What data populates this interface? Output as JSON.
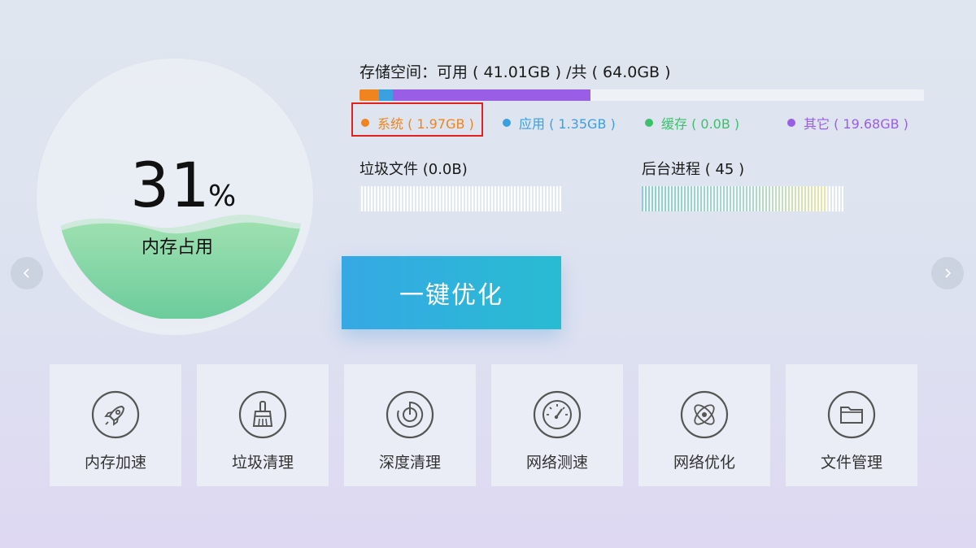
{
  "memory": {
    "percent": "31",
    "percent_sign": "%",
    "label": "内存占用"
  },
  "storage": {
    "title": "存储空间：可用 ( 41.01GB ) /共 ( 64.0GB )",
    "segments": [
      {
        "name": "系统",
        "size_gb": 1.97,
        "color": "#f0841e"
      },
      {
        "name": "应用",
        "size_gb": 1.35,
        "color": "#3aa0e0"
      },
      {
        "name": "缓存",
        "size_gb": 0.0,
        "color": "#3cc06a"
      },
      {
        "name": "其它",
        "size_gb": 19.68,
        "color": "#9a5ee6"
      }
    ],
    "total_gb": 64.0,
    "legend": {
      "system": "系统 ( 1.97GB )",
      "apps": "应用 ( 1.35GB )",
      "cache": "缓存 ( 0.0B )",
      "other": "其它 ( 19.68GB )"
    }
  },
  "junk": {
    "title": "垃圾文件 (0.0B)"
  },
  "processes": {
    "title": "后台进程 ( 45 )",
    "level": 0.91
  },
  "optimize_button": {
    "label": "一键优化"
  },
  "tools": [
    {
      "label": "内存加速",
      "icon": "rocket-icon"
    },
    {
      "label": "垃圾清理",
      "icon": "broom-icon"
    },
    {
      "label": "深度清理",
      "icon": "deep-clean-icon"
    },
    {
      "label": "网络测速",
      "icon": "speedometer-icon"
    },
    {
      "label": "网络优化",
      "icon": "atom-icon"
    },
    {
      "label": "文件管理",
      "icon": "folder-icon"
    }
  ],
  "colors": {
    "accent_from": "#36a8e4",
    "accent_to": "#28bcd2",
    "wave": "#8fd8a6",
    "highlight": "#e0221d"
  }
}
